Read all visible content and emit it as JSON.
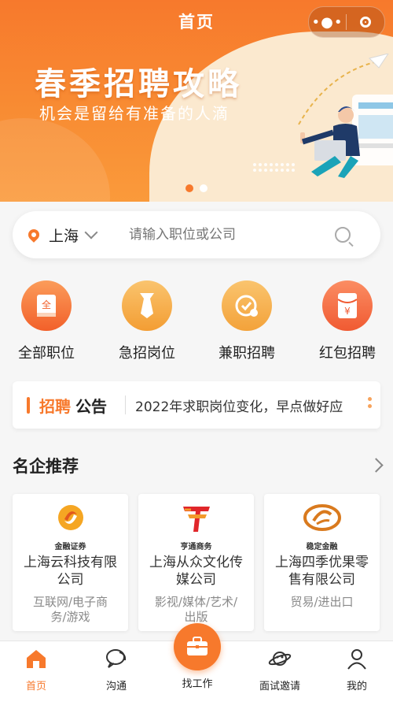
{
  "header": {
    "title": "首页"
  },
  "banner": {
    "title": "春季招聘攻略",
    "subtitle": "机会是留给有准备的人滴",
    "slides_total": 2,
    "slide_active": 1
  },
  "search": {
    "city": "上海",
    "placeholder": "请输入职位或公司"
  },
  "categories": [
    {
      "label": "全部职位",
      "icon": "book-icon"
    },
    {
      "label": "急招岗位",
      "icon": "tie-icon"
    },
    {
      "label": "兼职招聘",
      "icon": "clock-icon"
    },
    {
      "label": "红包招聘",
      "icon": "red-envelope-icon"
    }
  ],
  "notice": {
    "label_highlight": "招聘",
    "label_rest": "公告",
    "message": "2022年求职岗位变化，早点做好应"
  },
  "featured": {
    "title": "名企推荐",
    "companies": [
      {
        "logo_text": "金融证券",
        "name": "上海云科技有限公司",
        "industry": "互联网/电子商务/游戏"
      },
      {
        "logo_text": "亨通商务",
        "name": "上海从众文化传媒公司",
        "industry": "影视/媒体/艺术/出版"
      },
      {
        "logo_text": "稳定金融",
        "name": "上海四季优果零售有限公司",
        "industry": "贸易/进出口"
      }
    ]
  },
  "tabbar": {
    "items": [
      {
        "label": "首页",
        "icon": "home-icon"
      },
      {
        "label": "沟通",
        "icon": "chat-icon"
      },
      {
        "label": "找工作",
        "icon": "briefcase-icon"
      },
      {
        "label": "面试邀请",
        "icon": "planet-icon"
      },
      {
        "label": "我的",
        "icon": "user-icon"
      }
    ],
    "active": "首页"
  },
  "colors": {
    "accent": "#f7792c",
    "banner_start": "#f7792c",
    "banner_end": "#fa9a3b"
  }
}
